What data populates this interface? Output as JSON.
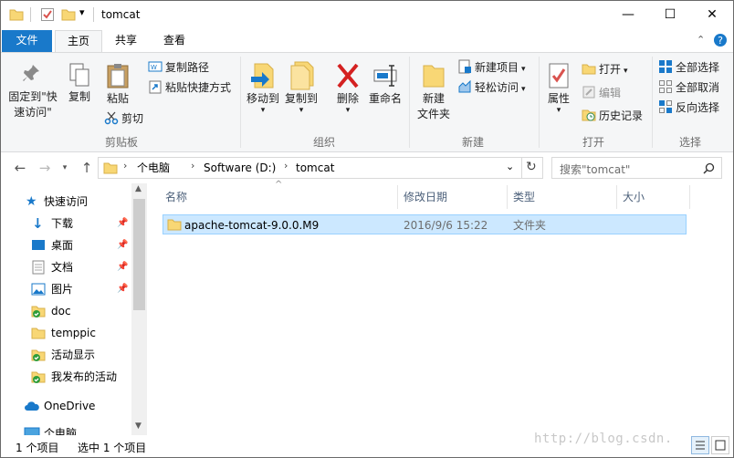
{
  "window": {
    "title": "tomcat",
    "minimize": "—",
    "maximize": "☐",
    "close": "✕"
  },
  "ribbon_tabs": {
    "file": "文件",
    "home": "主页",
    "share": "共享",
    "view": "查看"
  },
  "ribbon": {
    "clipboard": {
      "pin": "固定到\"快",
      "pin2": "速访问\"",
      "copy": "复制",
      "paste": "粘贴",
      "copy_path": "复制路径",
      "paste_shortcut": "粘贴快捷方式",
      "cut": "剪切",
      "group": "剪贴板"
    },
    "organize": {
      "move_to": "移动到",
      "copy_to": "复制到",
      "delete": "删除",
      "rename": "重命名",
      "group": "组织"
    },
    "new": {
      "new_folder": "新建",
      "new_folder2": "文件夹",
      "new_item": "新建项目",
      "easy_access": "轻松访问",
      "group": "新建"
    },
    "open": {
      "properties": "属性",
      "open": "打开",
      "edit": "编辑",
      "history": "历史记录",
      "group": "打开"
    },
    "select": {
      "select_all": "全部选择",
      "select_none": "全部取消",
      "invert": "反向选择",
      "group": "选择"
    }
  },
  "address": {
    "crumbs": [
      "个电脑",
      "Software (D:)",
      "tomcat"
    ],
    "search_placeholder": "搜索\"tomcat\""
  },
  "nav_pane": {
    "quick_access": "快速访问",
    "items": [
      {
        "label": "下载",
        "pinned": true
      },
      {
        "label": "桌面",
        "pinned": true
      },
      {
        "label": "文档",
        "pinned": true
      },
      {
        "label": "图片",
        "pinned": true
      },
      {
        "label": "doc",
        "pinned": false
      },
      {
        "label": "temppic",
        "pinned": false
      },
      {
        "label": "活动显示",
        "pinned": false
      },
      {
        "label": "我发布的活动",
        "pinned": false
      }
    ],
    "onedrive": "OneDrive",
    "this_pc": "个电脑"
  },
  "columns": {
    "name": "名称",
    "date": "修改日期",
    "type": "类型",
    "size": "大小"
  },
  "files": [
    {
      "name": "apache-tomcat-9.0.0.M9",
      "date": "2016/9/6 15:22",
      "type": "文件夹",
      "size": ""
    }
  ],
  "status": {
    "count": "1 个项目",
    "selected": "选中 1 个项目"
  },
  "watermark": "http://blog.csdn.",
  "colors": {
    "accent": "#1979ca",
    "selection": "#cce8ff",
    "folder": "#f8d775"
  }
}
